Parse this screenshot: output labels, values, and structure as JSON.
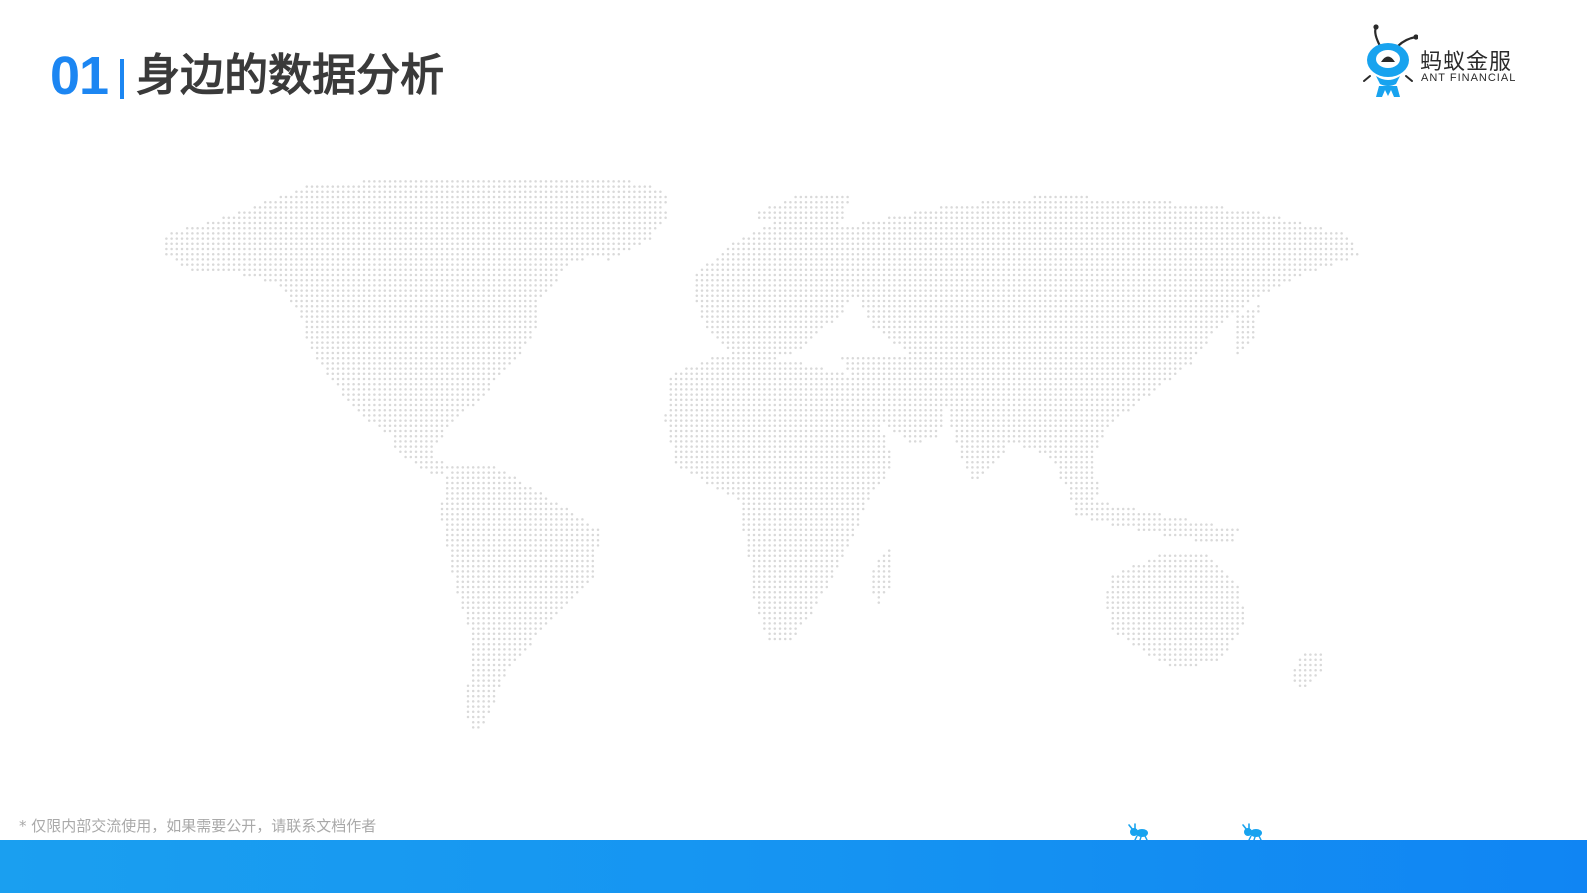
{
  "title": {
    "number": "01",
    "text": "身边的数据分析"
  },
  "logo": {
    "cn": "蚂蚁金服",
    "en": "ANT FINANCIAL"
  },
  "footnote": "* 仅限内部交流使用，如果需要公开，请联系文档作者",
  "colors": {
    "accent": "#1c86f2",
    "title_text": "#3a3a3a",
    "map_dot": "#d9d9d9",
    "footnote": "#a9a9a9",
    "band": "#1593f2",
    "mascot": "#18a3ef"
  },
  "icons": {
    "logo_mascot": "ant-mascot-icon",
    "map": "dotted-world-map",
    "ants": [
      "ant-icon",
      "ant-icon"
    ]
  }
}
